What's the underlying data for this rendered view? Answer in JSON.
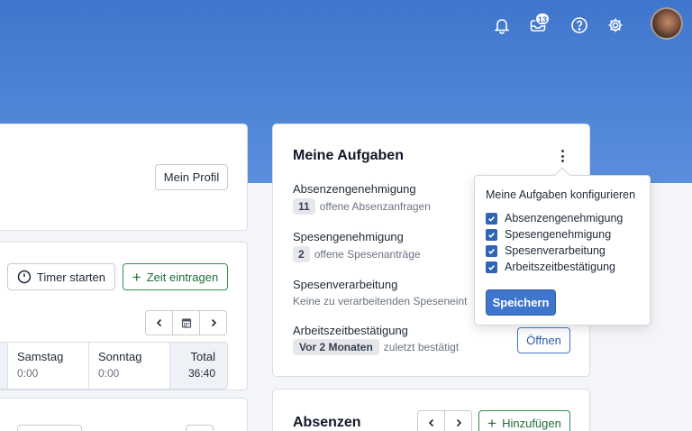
{
  "header": {
    "icons": [
      "bell-icon",
      "inbox-icon",
      "help-icon",
      "gear-icon"
    ],
    "inbox_badge": "13",
    "accent": "#3f76cd"
  },
  "left": {
    "profile_button": "Mein Profil",
    "timer_button": "Timer starten",
    "add_time_button": "Zeit eintragen",
    "days": [
      {
        "name": "Samstag",
        "value": "0:00"
      },
      {
        "name": "Sonntag",
        "value": "0:00"
      },
      {
        "name": "Total",
        "value": "36:40"
      }
    ]
  },
  "tasks": {
    "title": "Meine Aufgaben",
    "items": [
      {
        "label": "Absenzengenehmigung",
        "count": "11",
        "text": "offene Absenzanfragen"
      },
      {
        "label": "Spesengenehmigung",
        "count": "2",
        "text": "offene Spesenanträge"
      },
      {
        "label": "Spesenverarbeitung",
        "text": "Keine zu verarbeitenden Speseneint"
      },
      {
        "label": "Arbeitszeitbestätigung",
        "count": "Vor 2 Monaten",
        "text": "zuletzt bestätigt"
      }
    ],
    "open_button": "Öffnen"
  },
  "popover": {
    "title": "Meine Aufgaben konfigurieren",
    "options": [
      {
        "label": "Absenzengenehmigung",
        "checked": true
      },
      {
        "label": "Spesengenehmigung",
        "checked": true
      },
      {
        "label": "Spesenverarbeitung",
        "checked": true
      },
      {
        "label": "Arbeitszeitbestätigung",
        "checked": true
      }
    ],
    "save_button": "Speichern"
  },
  "absences": {
    "title": "Absenzen",
    "add_button": "Hinzufügen"
  }
}
